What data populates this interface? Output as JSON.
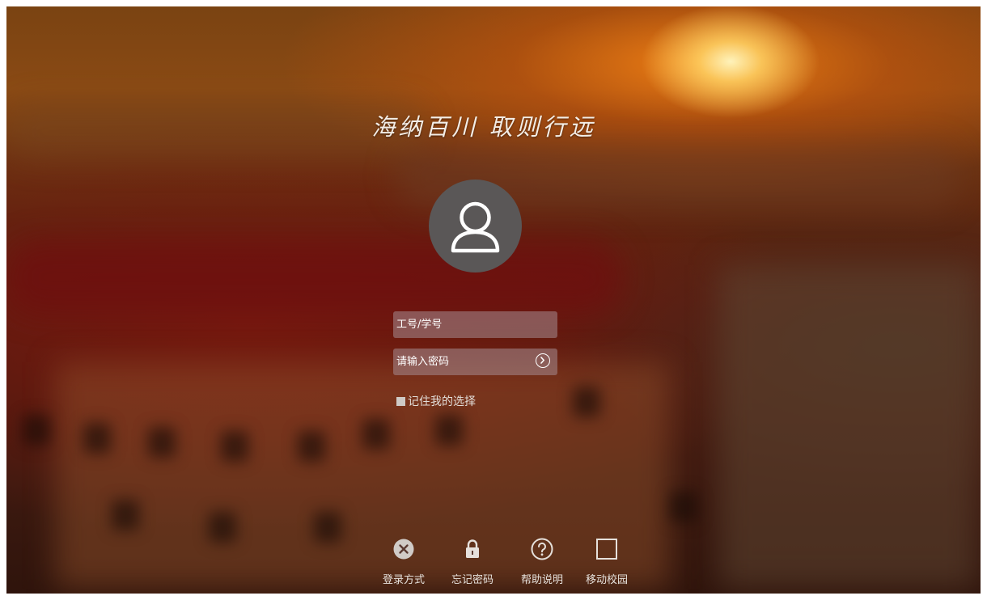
{
  "motto": "海纳百川 取则行远",
  "login": {
    "username_placeholder": "工号/学号",
    "password_placeholder": "请输入密码",
    "remember_label": "记住我的选择"
  },
  "footer": {
    "items": [
      {
        "label": "登录方式",
        "icon": "close-circle-icon"
      },
      {
        "label": "忘记密码",
        "icon": "lock-icon"
      },
      {
        "label": "帮助说明",
        "icon": "question-circle-icon"
      },
      {
        "label": "移动校园",
        "icon": "square-icon"
      }
    ]
  },
  "colors": {
    "avatar_bg": "#5a5757",
    "field_bg": "#a58c91",
    "text": "#ffffff"
  }
}
